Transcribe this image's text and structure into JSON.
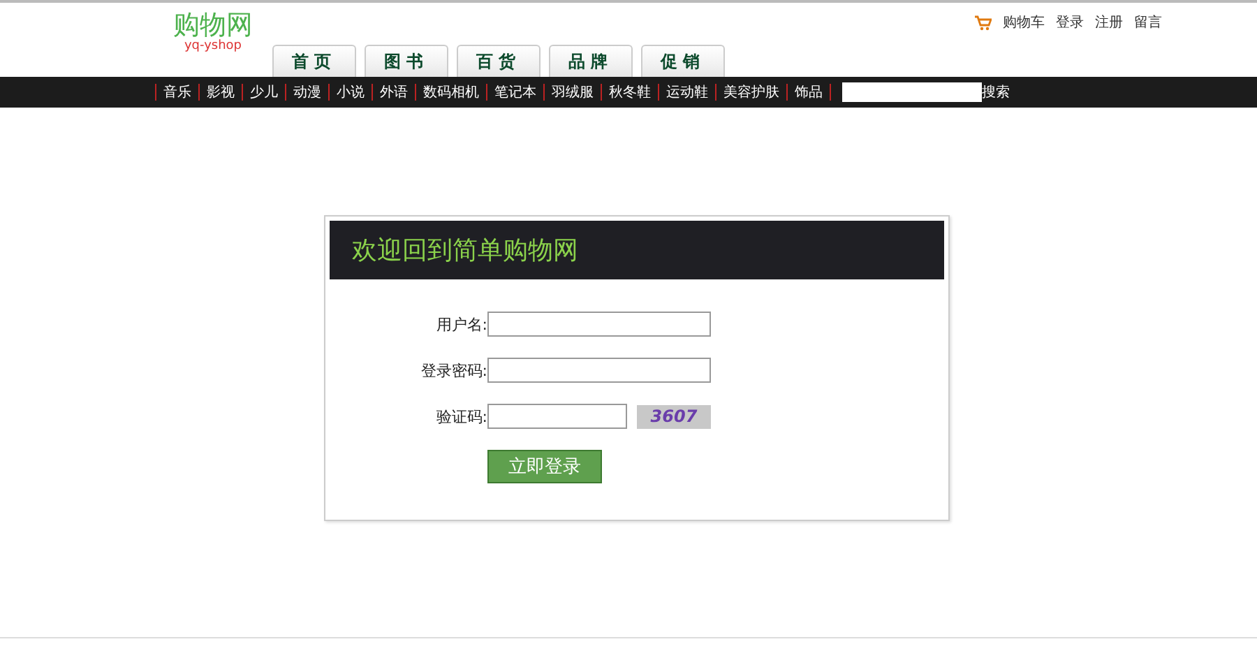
{
  "logo": {
    "title": "购物网",
    "subtitle": "yq-yshop"
  },
  "top_links": [
    "购物车",
    "登录",
    "注册",
    "留言"
  ],
  "tabs": [
    "首页",
    "图书",
    "百货",
    "品牌",
    "促销"
  ],
  "categories": [
    "音乐",
    "影视",
    "少儿",
    "动漫",
    "小说",
    "外语",
    "数码相机",
    "笔记本",
    "羽绒服",
    "秋冬鞋",
    "运动鞋",
    "美容护肤",
    "饰品"
  ],
  "search": {
    "button": "搜索"
  },
  "login": {
    "title": "欢迎回到简单购物网",
    "fields": [
      {
        "label": "用户名:",
        "kind": "text"
      },
      {
        "label": "登录密码:",
        "kind": "password"
      },
      {
        "label": "验证码:",
        "kind": "captcha",
        "captcha": "3607"
      }
    ],
    "submit": "立即登录"
  }
}
